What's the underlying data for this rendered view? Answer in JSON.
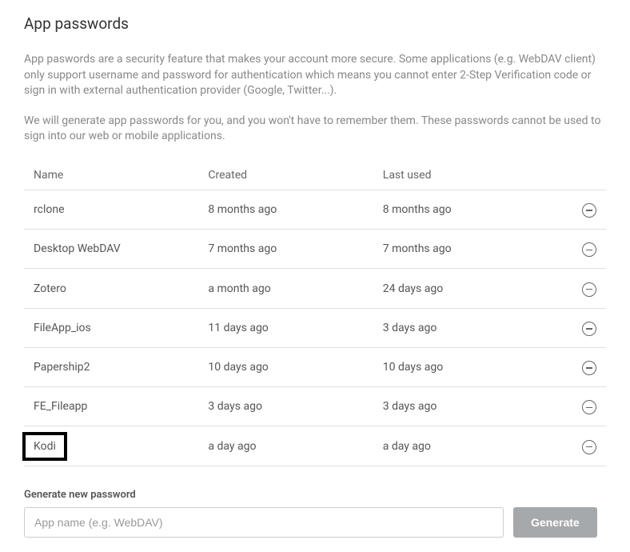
{
  "title": "App passwords",
  "description1": "App paswords are a security feature that makes your account more secure. Some applications (e.g. WebDAV client) only support username and password for authentication which means you cannot enter 2-Step Verification code or sign in with external authentication provider (Google, Twitter...).",
  "description2": "We will generate app passwords for you, and you won't have to remember them. These passwords cannot be used to sign into our web or mobile applications.",
  "columns": {
    "name": "Name",
    "created": "Created",
    "lastUsed": "Last used"
  },
  "rows": [
    {
      "name": "rclone",
      "created": "8 months ago",
      "lastUsed": "8 months ago",
      "highlight": false
    },
    {
      "name": "Desktop WebDAV",
      "created": "7 months ago",
      "lastUsed": "7 months ago",
      "highlight": false
    },
    {
      "name": "Zotero",
      "created": "a month ago",
      "lastUsed": "24 days ago",
      "highlight": false
    },
    {
      "name": "FileApp_ios",
      "created": "11 days ago",
      "lastUsed": "3 days ago",
      "highlight": false
    },
    {
      "name": "Papership2",
      "created": "10 days ago",
      "lastUsed": "10 days ago",
      "highlight": false
    },
    {
      "name": "FE_Fileapp",
      "created": "3 days ago",
      "lastUsed": "3 days ago",
      "highlight": false
    },
    {
      "name": "Kodi",
      "created": "a day ago",
      "lastUsed": "a day ago",
      "highlight": true
    }
  ],
  "generate": {
    "label": "Generate new password",
    "placeholder": "App name (e.g. WebDAV)",
    "button": "Generate"
  }
}
